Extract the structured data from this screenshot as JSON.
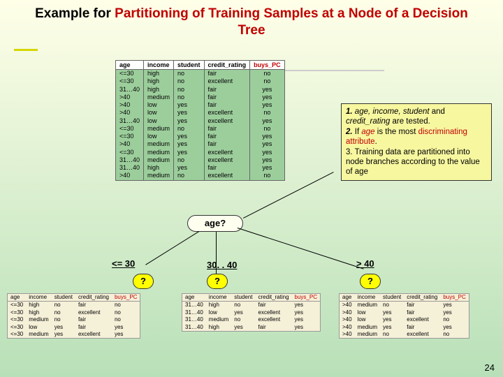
{
  "title": {
    "pre": "Example for ",
    "red": "Partitioning of Training Samples at a Node of a Decision Tree"
  },
  "headers": [
    "age",
    "income",
    "student",
    "credit_rating",
    "buys_PC"
  ],
  "rows": [
    [
      "<=30",
      "high",
      "no",
      "fair",
      "no"
    ],
    [
      "<=30",
      "high",
      "no",
      "excellent",
      "no"
    ],
    [
      "31…40",
      "high",
      "no",
      "fair",
      "yes"
    ],
    [
      ">40",
      "medium",
      "no",
      "fair",
      "yes"
    ],
    [
      ">40",
      "low",
      "yes",
      "fair",
      "yes"
    ],
    [
      ">40",
      "low",
      "yes",
      "excellent",
      "no"
    ],
    [
      "31…40",
      "low",
      "yes",
      "excellent",
      "yes"
    ],
    [
      "<=30",
      "medium",
      "no",
      "fair",
      "no"
    ],
    [
      "<=30",
      "low",
      "yes",
      "fair",
      "yes"
    ],
    [
      ">40",
      "medium",
      "yes",
      "fair",
      "yes"
    ],
    [
      "<=30",
      "medium",
      "yes",
      "excellent",
      "yes"
    ],
    [
      "31…40",
      "medium",
      "no",
      "excellent",
      "yes"
    ],
    [
      "31…40",
      "high",
      "yes",
      "fair",
      "yes"
    ],
    [
      ">40",
      "medium",
      "no",
      "excellent",
      "no"
    ]
  ],
  "callout": {
    "line1a": "1. ",
    "line1_attrs": "age, income, student",
    "line1b": "and ",
    "line1_cr": "credit_rating ",
    "line1c": "are tested.",
    "line2a": "2. ",
    "line2b": "If ",
    "line2_age": "age ",
    "line2c": "is the most ",
    "line2_red": "discriminating attribute",
    "line2d": ".",
    "line3": "3. Training data are partitioned  into node branches according to the value of age"
  },
  "age_node": "age?",
  "branches": {
    "left": "<= 30",
    "mid": "30. . 40",
    "right": "> 40"
  },
  "q": "?",
  "sub_left": [
    [
      "<=30",
      "high",
      "no",
      "fair",
      "no"
    ],
    [
      "<=30",
      "high",
      "no",
      "excellent",
      "no"
    ],
    [
      "<=30",
      "medium",
      "no",
      "fair",
      "no"
    ],
    [
      "<=30",
      "low",
      "yes",
      "fair",
      "yes"
    ],
    [
      "<=30",
      "medium",
      "yes",
      "excellent",
      "yes"
    ]
  ],
  "sub_mid": [
    [
      "31…40",
      "high",
      "no",
      "fair",
      "yes"
    ],
    [
      "31…40",
      "low",
      "yes",
      "excellent",
      "yes"
    ],
    [
      "31…40",
      "medium",
      "no",
      "excellent",
      "yes"
    ],
    [
      "31…40",
      "high",
      "yes",
      "fair",
      "yes"
    ]
  ],
  "sub_right": [
    [
      ">40",
      "medium",
      "no",
      "fair",
      "yes"
    ],
    [
      ">40",
      "low",
      "yes",
      "fair",
      "yes"
    ],
    [
      ">40",
      "low",
      "yes",
      "excellent",
      "no"
    ],
    [
      ">40",
      "medium",
      "yes",
      "fair",
      "yes"
    ],
    [
      ">40",
      "medium",
      "no",
      "excellent",
      "no"
    ]
  ],
  "page": "24"
}
